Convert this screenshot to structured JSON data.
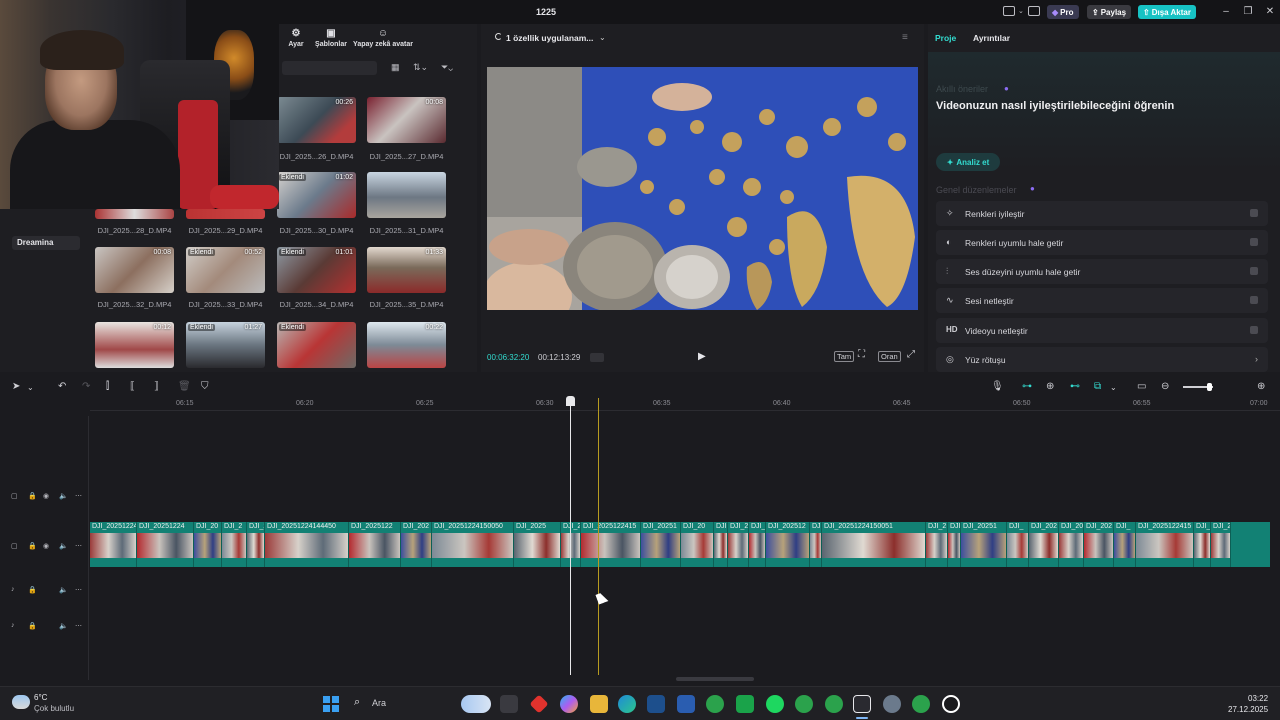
{
  "window": {
    "title": "1225",
    "pro_label": "Pro",
    "share_label": "Paylaş",
    "export_label": "Dışa Aktar"
  },
  "media_toolbar": {
    "items": [
      "Ayar",
      "Şablonlar",
      "Yapay zekâ avatar"
    ]
  },
  "sidebar": {
    "dreamina": "Dreamina"
  },
  "media": {
    "added_label": "Eklendi",
    "thumbs": [
      {
        "name": "DJI_2025...26_D.MP4",
        "duration": "00:26",
        "added": false
      },
      {
        "name": "DJI_2025...27_D.MP4",
        "duration": "00:08",
        "added": false
      },
      {
        "name": "DJI_2025...28_D.MP4",
        "duration": "",
        "added": false
      },
      {
        "name": "DJI_2025...29_D.MP4",
        "duration": "",
        "added": false
      },
      {
        "name": "DJI_2025...30_D.MP4",
        "duration": "01:02",
        "added": true
      },
      {
        "name": "DJI_2025...31_D.MP4",
        "duration": "",
        "added": false
      },
      {
        "name": "DJI_2025...32_D.MP4",
        "duration": "00:08",
        "added": true
      },
      {
        "name": "DJI_2025...33_D.MP4",
        "duration": "00:52",
        "added": true
      },
      {
        "name": "DJI_2025...34_D.MP4",
        "duration": "01:01",
        "added": true
      },
      {
        "name": "DJI_2025...35_D.MP4",
        "duration": "01:33",
        "added": false
      },
      {
        "name": "",
        "duration": "00:12",
        "added": false
      },
      {
        "name": "",
        "duration": "01:27",
        "added": true
      },
      {
        "name": "",
        "duration": "",
        "added": true
      },
      {
        "name": "",
        "duration": "00:22",
        "added": false
      }
    ]
  },
  "player": {
    "status": "1 özellik uygulanam...",
    "current_time": "00:06:32:20",
    "total_time": "00:12:13:29",
    "full_label": "Tam",
    "ratio_label": "Oran"
  },
  "right_panel": {
    "tab_project": "Proje",
    "tab_details": "Ayrıntılar",
    "faded_heading": "Akıllı öneriler",
    "heading": "Videonuzun nasıl iyileştirilebileceğini öğrenin",
    "analyze": "Analiz et",
    "section": "Genel düzenlemeler",
    "options": [
      {
        "icon": "magic-wand-icon",
        "label": "Renkleri iyileştir"
      },
      {
        "icon": "palette-icon",
        "label": "Renkleri uyumlu hale getir"
      },
      {
        "icon": "sliders-icon",
        "label": "Ses düzeyini uyumlu hale getir"
      },
      {
        "icon": "waveform-icon",
        "label": "Sesi netleştir"
      },
      {
        "icon": "hd-icon",
        "label": "Videoyu netleştir"
      },
      {
        "icon": "face-retouch-icon",
        "label": "Yüz rötuşu"
      }
    ]
  },
  "timeline": {
    "ticks": [
      "06:15",
      "06:20",
      "06:25",
      "06:30",
      "06:35",
      "06:40",
      "06:45",
      "06:50",
      "06:55",
      "07:00"
    ],
    "clips": [
      "DJI_20251224",
      "DJI_20251224",
      "DJI_20",
      "DJI_2",
      "DJI_2",
      "DJI_20251224144450",
      "DJI_2025122",
      "DJI_202",
      "DJI_20251224150050",
      "DJI_2025",
      "DJI_2",
      "DJI_2025122415",
      "DJI_20251",
      "DJI_20",
      "DJI",
      "DJI_2",
      "DJI_2",
      "DJI_202512",
      "DJI_",
      "DJI_20251224150051",
      "DJI_2",
      "DJI",
      "DJI_20251",
      "DJI_",
      "DJI_202",
      "DJI_20",
      "DJI_202",
      "DJI_",
      "DJI_2025122415",
      "DJI_20",
      "DJI_202"
    ]
  },
  "taskbar": {
    "temperature": "6°C",
    "weather": "Çok bulutlu",
    "search_placeholder": "Ara",
    "time": "03:22",
    "date": "27.12.2025"
  },
  "colors": {
    "accent": "#33dcd0",
    "clip_teal": "#128174",
    "export_button": "#17c2c4",
    "pro_badge": "#3a3a52"
  }
}
